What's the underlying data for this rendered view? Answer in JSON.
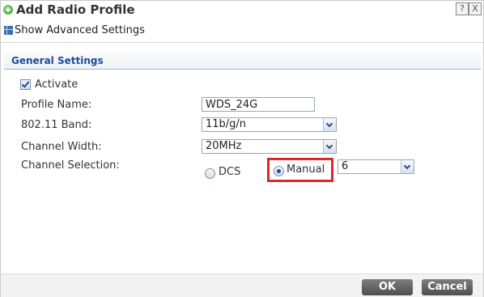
{
  "dialog": {
    "title": "Add Radio Profile",
    "help_label": "?",
    "close_label": "X"
  },
  "toolbar": {
    "advanced_label": "Show Advanced Settings"
  },
  "section": {
    "title": "General Settings"
  },
  "form": {
    "activate": {
      "label": "Activate",
      "checked": true
    },
    "profile_name": {
      "label": "Profile Name:",
      "value": "WDS_24G"
    },
    "band": {
      "label": "802.11 Band:",
      "value": "11b/g/n"
    },
    "channel_width": {
      "label": "Channel Width:",
      "value": "20MHz"
    },
    "channel_selection": {
      "label": "Channel Selection:",
      "options": [
        {
          "label": "DCS",
          "selected": false
        },
        {
          "label": "Manual",
          "selected": true
        }
      ],
      "channel_value": "6"
    }
  },
  "footer": {
    "ok_label": "OK",
    "cancel_label": "Cancel"
  },
  "colors": {
    "section_title": "#1f4a98",
    "highlight": "#e0262e",
    "button": "#5e5e5e"
  },
  "icons": {
    "title": "add-circle-icon",
    "advanced": "table-icon",
    "help": "help-icon",
    "close": "close-icon"
  }
}
